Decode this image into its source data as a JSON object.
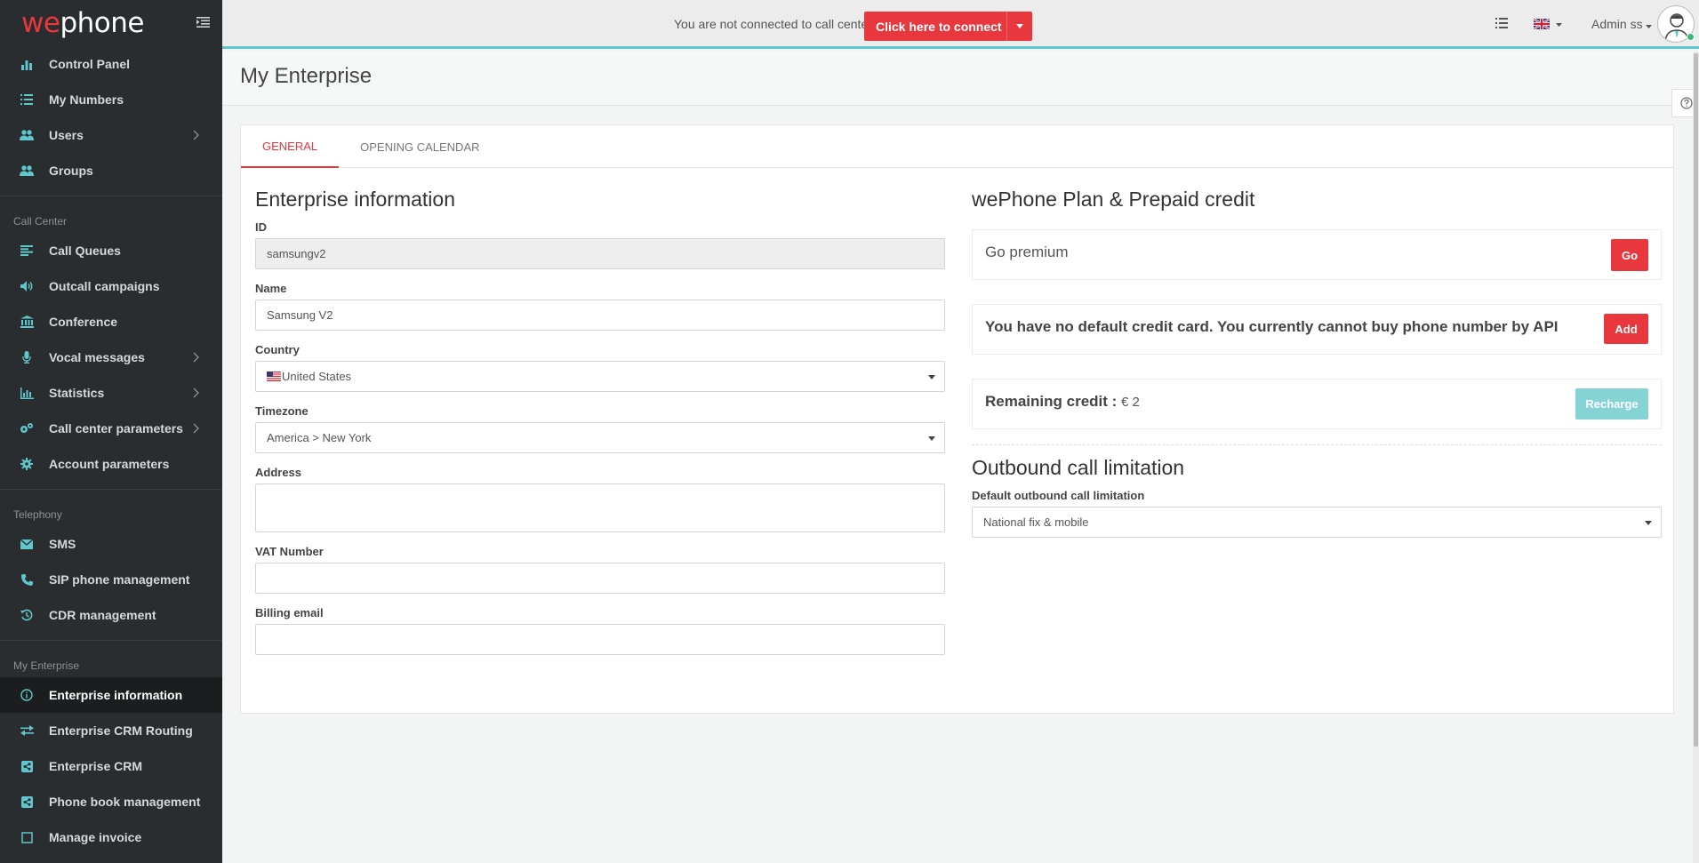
{
  "logo": {
    "we": "we",
    "phone": "phone"
  },
  "sidebar": {
    "main": [
      {
        "label": "Control Panel"
      },
      {
        "label": "My Numbers"
      },
      {
        "label": "Users"
      },
      {
        "label": "Groups"
      }
    ],
    "call_center_title": "Call Center",
    "call_center": [
      {
        "label": "Call Queues"
      },
      {
        "label": "Outcall campaigns"
      },
      {
        "label": "Conference"
      },
      {
        "label": "Vocal messages"
      },
      {
        "label": "Statistics"
      },
      {
        "label": "Call center parameters"
      },
      {
        "label": "Account parameters"
      }
    ],
    "telephony_title": "Telephony",
    "telephony": [
      {
        "label": "SMS"
      },
      {
        "label": "SIP phone management"
      },
      {
        "label": "CDR management"
      }
    ],
    "enterprise_title": "My Enterprise",
    "enterprise": [
      {
        "label": "Enterprise information"
      },
      {
        "label": "Enterprise CRM Routing"
      },
      {
        "label": "Enterprise CRM"
      },
      {
        "label": "Phone book management"
      },
      {
        "label": "Manage invoice"
      }
    ]
  },
  "topbar": {
    "status_text": "You are not connected to call center",
    "connect_label": "Click here to connect",
    "user_label": "Admin ss"
  },
  "page": {
    "title": "My Enterprise"
  },
  "tabs": [
    {
      "label": "GENERAL"
    },
    {
      "label": "OPENING CALENDAR"
    }
  ],
  "enterprise": {
    "heading": "Enterprise information",
    "id_label": "ID",
    "id_value": "samsungv2",
    "name_label": "Name",
    "name_value": "Samsung V2",
    "country_label": "Country",
    "country_value": "United States",
    "timezone_label": "Timezone",
    "timezone_value": "America > New York",
    "address_label": "Address",
    "address_value": "",
    "vat_label": "VAT Number",
    "vat_value": "",
    "billing_label": "Billing email",
    "billing_value": ""
  },
  "plan": {
    "heading": "wePhone Plan & Prepaid credit",
    "premium_text": "Go premium",
    "go_label": "Go",
    "card_text": "You have no default credit card. You currently cannot buy phone number by API",
    "add_label": "Add",
    "credit_label": "Remaining credit :",
    "credit_value": "€ 2",
    "recharge_label": "Recharge"
  },
  "outbound": {
    "heading": "Outbound call limitation",
    "label": "Default outbound call limitation",
    "value": "National fix & mobile"
  },
  "colors": {
    "accent": "#e8373d",
    "teal": "#5fc7cc",
    "sidebar": "#2a2d2f"
  }
}
